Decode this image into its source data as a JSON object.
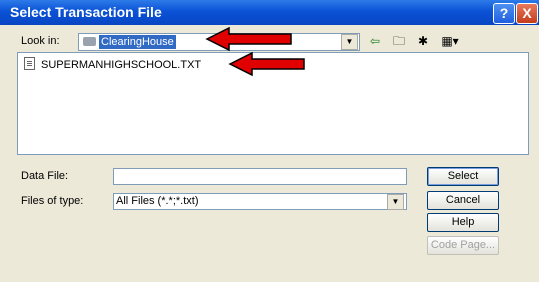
{
  "title": "Select Transaction File",
  "title_buttons": {
    "help": "?",
    "close": "X"
  },
  "look_in": {
    "label": "Look in:",
    "value": "ClearingHouse"
  },
  "files": [
    {
      "name": "SUPERMANHIGHSCHOOL.TXT"
    }
  ],
  "data_file": {
    "label": "Data File:",
    "value": ""
  },
  "files_of_type": {
    "label": "Files of type:",
    "value": "All Files (*.*;*.txt)"
  },
  "buttons": {
    "select": "Select",
    "cancel": "Cancel",
    "help": "Help",
    "code_page": "Code Page..."
  },
  "colors": {
    "title_bar": "#0a52d6",
    "annotation_arrow": "#e00000",
    "selection": "#316ac5"
  }
}
